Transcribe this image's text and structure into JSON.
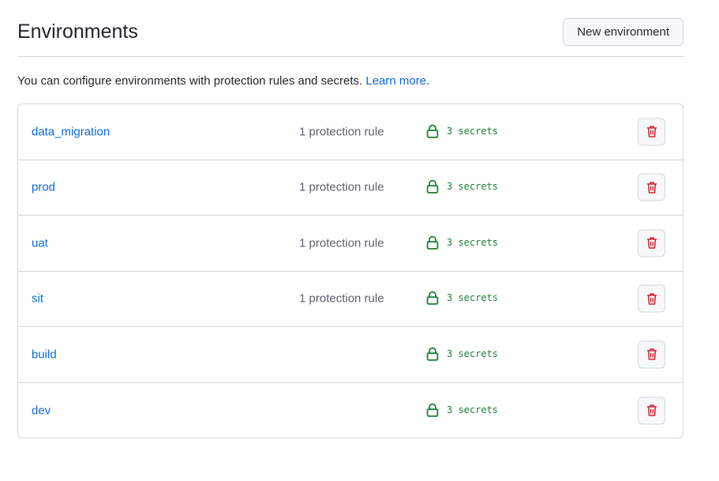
{
  "header": {
    "title": "Environments",
    "new_button_label": "New environment"
  },
  "description": {
    "text": "You can configure environments with protection rules and secrets. ",
    "link_text": "Learn more",
    "suffix": "."
  },
  "colors": {
    "link": "#0969da",
    "secrets_green": "#1a7f37",
    "danger_red": "#cf222e",
    "border": "#d0d7de"
  },
  "environments": [
    {
      "name": "data_migration",
      "rules": "1 protection rule",
      "secrets": "3 secrets"
    },
    {
      "name": "prod",
      "rules": "1 protection rule",
      "secrets": "3 secrets"
    },
    {
      "name": "uat",
      "rules": "1 protection rule",
      "secrets": "3 secrets"
    },
    {
      "name": "sit",
      "rules": "1 protection rule",
      "secrets": "3 secrets"
    },
    {
      "name": "build",
      "rules": "",
      "secrets": "3 secrets"
    },
    {
      "name": "dev",
      "rules": "",
      "secrets": "3 secrets"
    }
  ],
  "icons": {
    "secrets": "lock-icon",
    "delete": "trash-icon"
  }
}
